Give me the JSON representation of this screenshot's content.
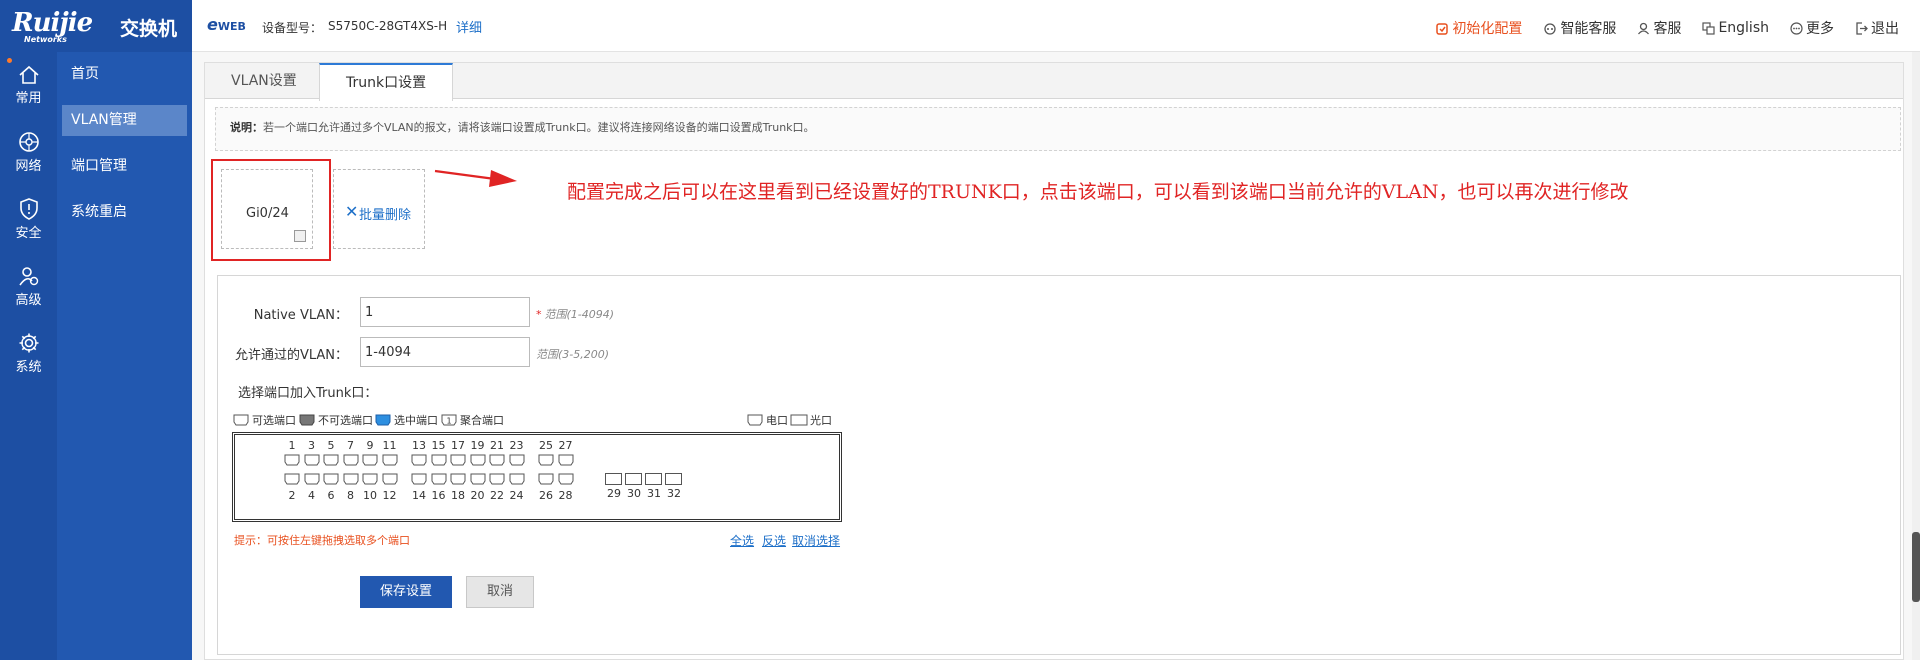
{
  "brand": {
    "logo": "Ruijie",
    "logo_sub": "Networks",
    "title": "交换机"
  },
  "header": {
    "eweb": "e",
    "eweb_suffix": "WEB",
    "model_label": "设备型号：",
    "model_value": "S5750C-28GT4XS-H",
    "detail_link": "详细",
    "nav": [
      {
        "label": "初始化配置",
        "icon": "reset-icon"
      },
      {
        "label": "智能客服",
        "icon": "smart-service-icon"
      },
      {
        "label": "客服",
        "icon": "service-icon"
      },
      {
        "label": "English",
        "icon": "language-icon"
      },
      {
        "label": "更多",
        "icon": "more-icon"
      },
      {
        "label": "退出",
        "icon": "logout-icon"
      }
    ]
  },
  "iconbar": [
    {
      "label": "常用",
      "icon": "home-icon"
    },
    {
      "label": "网络",
      "icon": "network-icon"
    },
    {
      "label": "安全",
      "icon": "shield-icon"
    },
    {
      "label": "高级",
      "icon": "advanced-icon"
    },
    {
      "label": "系统",
      "icon": "gear-icon"
    }
  ],
  "subnav": [
    "首页",
    "VLAN管理",
    "端口管理",
    "系统重启"
  ],
  "tabs": [
    "VLAN设置",
    "Trunk口设置"
  ],
  "notice": {
    "label": "说明：",
    "text": "若一个端口允许通过多个VLAN的报文，请将该端口设置成Trunk口。建议将连接网络设备的端口设置成Trunk口。"
  },
  "trunk_port": {
    "name": "Gi0/24"
  },
  "bulk_delete": {
    "icon": "✕",
    "label": "批量删除"
  },
  "annotation": "配置完成之后可以在这里看到已经设置好的TRUNK口，点击该端口，可以看到该端口当前允许的VLAN，也可以再次进行修改",
  "form": {
    "native_label": "Native VLAN：",
    "native_value": "1",
    "native_hint_star": "*",
    "native_hint": "范围(1-4094)",
    "allowed_label": "允许通过的VLAN：",
    "allowed_value": "1-4094",
    "allowed_hint": "范围(3-5,200)",
    "select_title": "选择端口加入Trunk口："
  },
  "legend": {
    "available": "可选端口",
    "unavailable": "不可选端口",
    "selected": "选中端口",
    "aggregate": "聚合端口",
    "aggregate_mark": "1",
    "electric": "电口",
    "optical": "光口"
  },
  "ports": {
    "top_row": [
      "1",
      "3",
      "5",
      "7",
      "9",
      "11",
      "13",
      "15",
      "17",
      "19",
      "21",
      "23",
      "25",
      "27"
    ],
    "bottom_row": [
      "2",
      "4",
      "6",
      "8",
      "10",
      "12",
      "14",
      "16",
      "18",
      "20",
      "22",
      "24",
      "26",
      "28"
    ],
    "fiber": [
      "29",
      "30",
      "31",
      "32"
    ]
  },
  "tip": "提示：可按住左键拖拽选取多个端口",
  "actions": {
    "select_all": "全选",
    "invert": "反选",
    "deselect": "取消选择"
  },
  "buttons": {
    "save": "保存设置",
    "cancel": "取消"
  },
  "colors": {
    "brand": "#1d4fa3",
    "accent": "#e8501f",
    "annotation": "#e02424",
    "link": "#1d6fc8"
  }
}
